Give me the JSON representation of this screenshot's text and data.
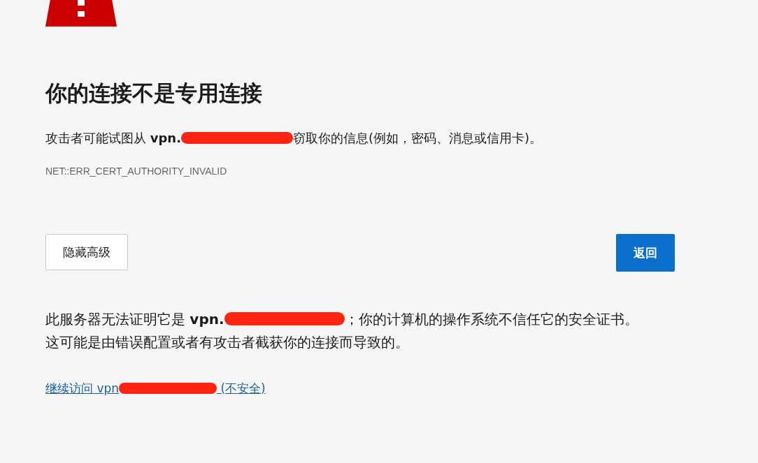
{
  "title": "你的连接不是专用连接",
  "summary": {
    "before": "攻击者可能试图从 ",
    "host": "vpn.",
    "after": "窃取你的信息(例如，密码、消息或信用卡)。",
    "redacted": true
  },
  "error_code": "NET::ERR_CERT_AUTHORITY_INVALID",
  "buttons": [
    {
      "label": "隐藏高级",
      "kind": "secondary"
    },
    {
      "label": "返回",
      "kind": "primary"
    }
  ],
  "details": {
    "before": "此服务器无法证明它是 ",
    "host": "vpn.",
    "after": "；你的计算机的操作系统不信任它的安全证书。这可能是由错误配置或者有攻击者截获你的连接而导致的。",
    "redacted": true
  },
  "proceed_link": {
    "before": "继续访问 vpn",
    "after": " (不安全)",
    "redacted": true
  }
}
